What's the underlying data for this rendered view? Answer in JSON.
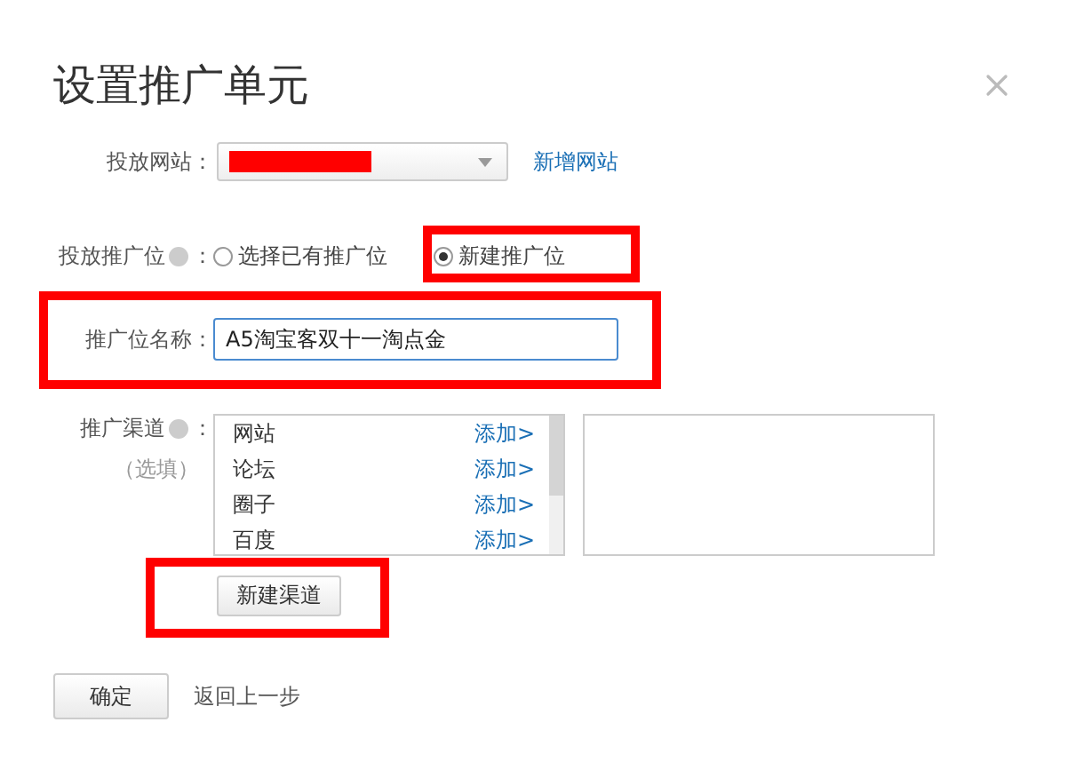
{
  "dialog": {
    "title": "设置推广单元"
  },
  "site": {
    "label": "投放网站：",
    "redacted": true,
    "link": "新增网站"
  },
  "slot": {
    "label": "投放推广位",
    "colon": "：",
    "options": [
      {
        "label": "选择已有推广位",
        "selected": false
      },
      {
        "label": "新建推广位",
        "selected": true
      }
    ]
  },
  "slot_name": {
    "label": "推广位名称：",
    "value": "A5淘宝客双十一淘点金"
  },
  "channels": {
    "label": "推广渠道",
    "colon": "：",
    "hint": "（选填）",
    "items": [
      {
        "name": "网站",
        "action": "添加>"
      },
      {
        "name": "论坛",
        "action": "添加>"
      },
      {
        "name": "圈子",
        "action": "添加>"
      },
      {
        "name": "百度",
        "action": "添加>"
      }
    ],
    "new_button": "新建渠道"
  },
  "footer": {
    "confirm": "确定",
    "back": "返回上一步"
  },
  "highlights": [
    {
      "kind": "radio"
    },
    {
      "kind": "name"
    },
    {
      "kind": "button"
    }
  ]
}
